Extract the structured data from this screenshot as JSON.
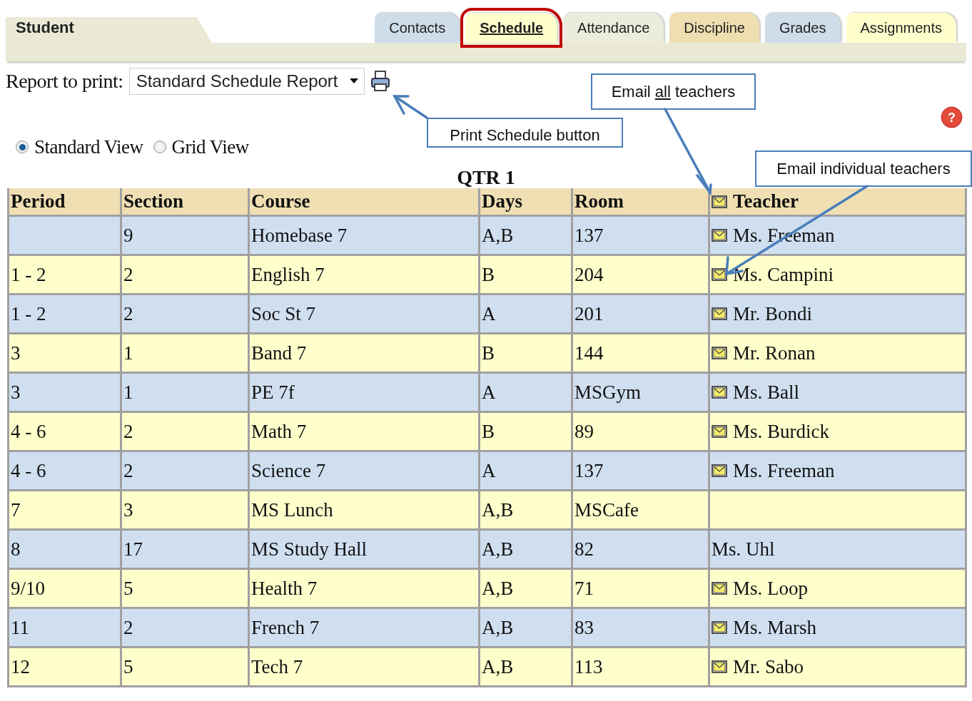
{
  "header": {
    "title": "Student"
  },
  "tabs": [
    {
      "label": "Contacts",
      "selected": false,
      "highlighted": false,
      "color": "#cfdcea"
    },
    {
      "label": "Schedule",
      "selected": true,
      "highlighted": true,
      "color": "#ffffcc"
    },
    {
      "label": "Attendance",
      "selected": false,
      "highlighted": false,
      "color": "#ececdc"
    },
    {
      "label": "Discipline",
      "selected": false,
      "highlighted": false,
      "color": "#eedeb0"
    },
    {
      "label": "Grades",
      "selected": false,
      "highlighted": false,
      "color": "#cfdcea"
    },
    {
      "label": "Assignments",
      "selected": false,
      "highlighted": false,
      "color": "#ffffcc"
    }
  ],
  "report": {
    "label": "Report to print:",
    "value": "Standard Schedule Report"
  },
  "views": [
    {
      "label": "Standard View",
      "selected": true
    },
    {
      "label": "Grid View",
      "selected": false
    }
  ],
  "table": {
    "title": "QTR 1",
    "columns": [
      {
        "label": "Period",
        "email": false
      },
      {
        "label": "Section",
        "email": false
      },
      {
        "label": "Course",
        "email": false
      },
      {
        "label": "Days",
        "email": false
      },
      {
        "label": "Room",
        "email": false
      },
      {
        "label": "Teacher",
        "email": true
      }
    ],
    "rows": [
      {
        "cells": [
          "",
          "9",
          "Homebase 7",
          "A,B",
          "137",
          "Ms. Freeman"
        ],
        "email": true
      },
      {
        "cells": [
          "1 - 2",
          "2",
          "English 7",
          "B",
          "204",
          "Ms. Campini"
        ],
        "email": true
      },
      {
        "cells": [
          "1 - 2",
          "2",
          "Soc St 7",
          "A",
          "201",
          "Mr. Bondi"
        ],
        "email": true
      },
      {
        "cells": [
          "3",
          "1",
          "Band 7",
          "B",
          "144",
          "Mr. Ronan"
        ],
        "email": true
      },
      {
        "cells": [
          "3",
          "1",
          "PE 7f",
          "A",
          "MSGym",
          "Ms. Ball"
        ],
        "email": true
      },
      {
        "cells": [
          "4 - 6",
          "2",
          "Math 7",
          "B",
          "89",
          "Ms. Burdick"
        ],
        "email": true
      },
      {
        "cells": [
          "4 - 6",
          "2",
          "Science 7",
          "A",
          "137",
          "Ms. Freeman"
        ],
        "email": true
      },
      {
        "cells": [
          "7",
          "3",
          "MS Lunch",
          "A,B",
          "MSCafe",
          ""
        ],
        "email": false
      },
      {
        "cells": [
          "8",
          "17",
          "MS Study Hall",
          "A,B",
          "82",
          "Ms. Uhl"
        ],
        "email": false
      },
      {
        "cells": [
          "9/10",
          "5",
          "Health 7",
          "A,B",
          "71",
          "Ms. Loop"
        ],
        "email": true
      },
      {
        "cells": [
          "11",
          "2",
          "French 7",
          "A,B",
          "83",
          "Ms. Marsh"
        ],
        "email": true
      },
      {
        "cells": [
          "12",
          "5",
          "Tech 7",
          "A,B",
          "113",
          "Mr. Sabo"
        ],
        "email": true
      }
    ]
  },
  "help": {
    "label": "?"
  },
  "callouts": [
    {
      "kind": "emphasis",
      "before": "Email ",
      "underlined": "all",
      "after": " teachers"
    },
    {
      "kind": "plain",
      "text": "Print Schedule button"
    },
    {
      "kind": "plain",
      "text": "Email individual teachers"
    }
  ]
}
